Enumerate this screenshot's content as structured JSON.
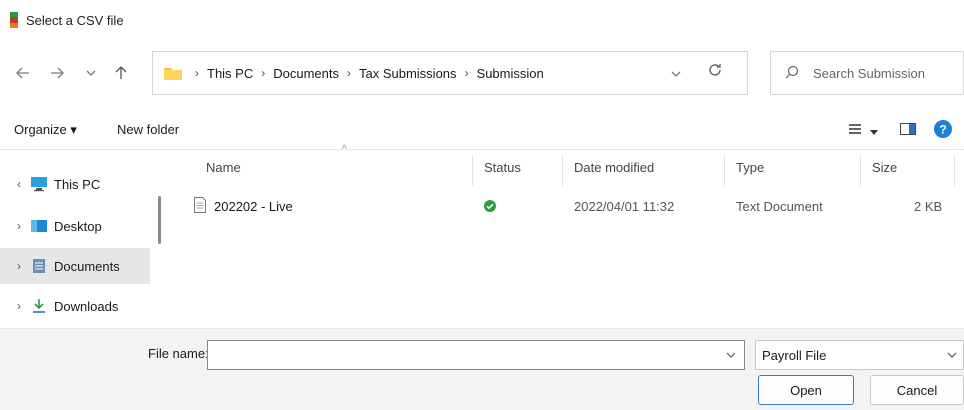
{
  "window": {
    "title": "Select a CSV file",
    "icon": "csv-app-icon"
  },
  "nav": {
    "back_icon": "back-arrow-icon",
    "forward_icon": "forward-arrow-icon",
    "recent_icon": "recent-dropdown-icon",
    "up_icon": "up-arrow-icon",
    "breadcrumb": [
      "This PC",
      "Documents",
      "Tax Submissions",
      "Submission"
    ],
    "search_placeholder": "Search Submission"
  },
  "toolbar": {
    "organize_label": "Organize ▾",
    "new_folder_label": "New folder"
  },
  "sidebar": {
    "items": [
      {
        "label": "This PC",
        "icon": "computer-icon",
        "chevron": "expanded"
      },
      {
        "label": "Desktop",
        "icon": "desktop-folder-icon",
        "chevron": "collapsed"
      },
      {
        "label": "Documents",
        "icon": "documents-folder-icon",
        "chevron": "collapsed",
        "selected": true
      },
      {
        "label": "Downloads",
        "icon": "downloads-icon",
        "chevron": "collapsed"
      }
    ]
  },
  "columns": {
    "name": "Name",
    "status": "Status",
    "date_modified": "Date modified",
    "type": "Type",
    "size": "Size"
  },
  "files": [
    {
      "name": "202202 - Live",
      "icon": "text-document-icon",
      "status_icon": "synced-check-icon",
      "date_modified": "2022/04/01 11:32",
      "type": "Text Document",
      "size": "2 KB"
    }
  ],
  "footer": {
    "file_name_label": "File name:",
    "file_name_value": "",
    "file_type_value": "Payroll File",
    "open_label": "Open",
    "cancel_label": "Cancel"
  },
  "colors": {
    "accent": "#3a78d4",
    "status_green": "#2e9a3e",
    "folder_yellow": "#f5c342",
    "help_blue": "#1e7fd9"
  }
}
